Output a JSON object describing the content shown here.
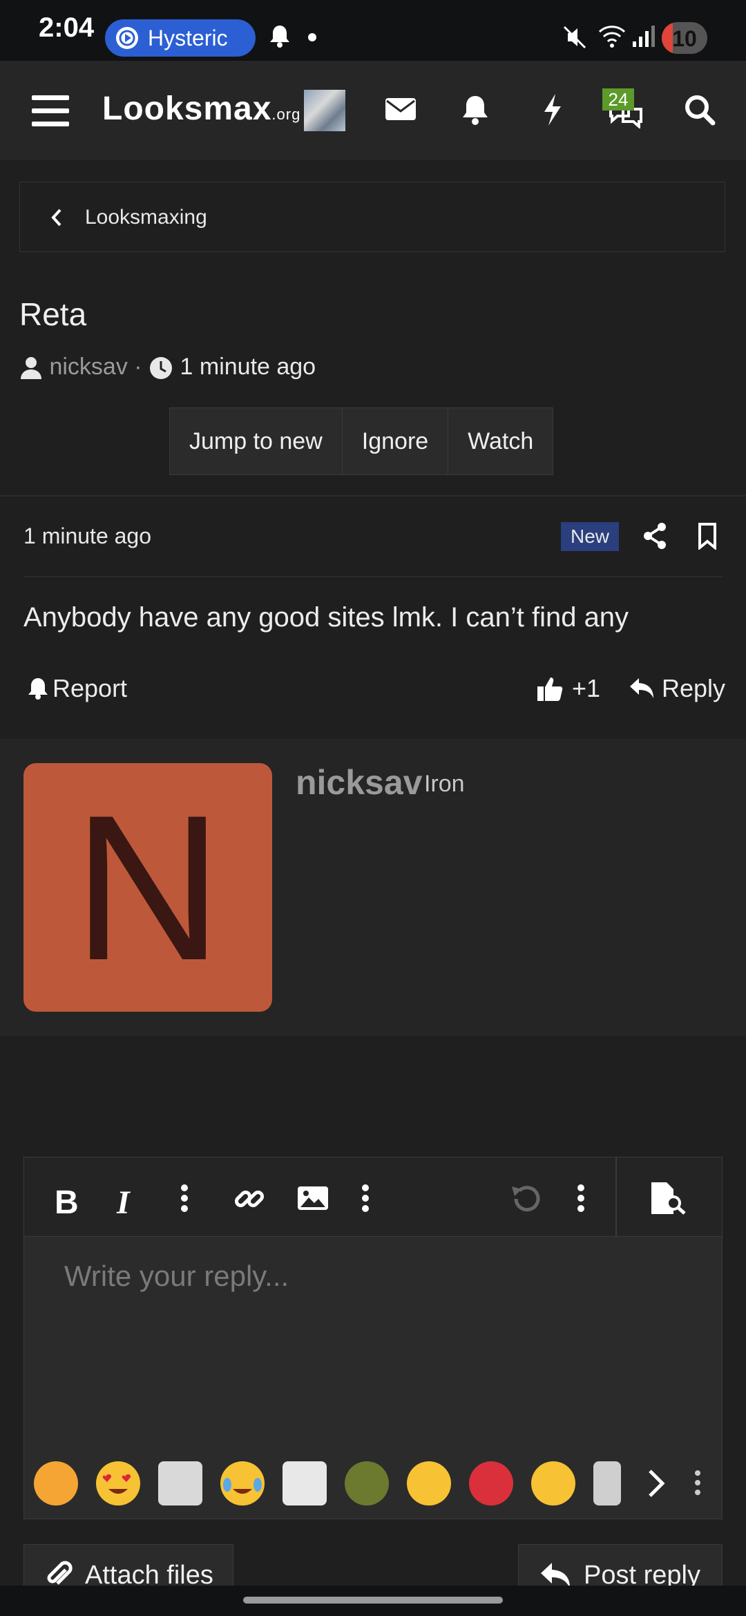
{
  "status_bar": {
    "time": "2:04",
    "media_pill_label": "Hysteric",
    "battery_level": "10",
    "icons": [
      "media-icon",
      "notification-bell-icon",
      "dot-icon",
      "mute-icon",
      "wifi-icon",
      "signal-icon",
      "battery-icon"
    ]
  },
  "header": {
    "logo_main": "Looksmax",
    "logo_suffix": ".org",
    "chat_badge": "24",
    "icons": [
      "menu-icon",
      "mail-icon",
      "bell-icon",
      "lightning-icon",
      "chat-icon",
      "search-icon"
    ]
  },
  "breadcrumb": {
    "label": "Looksmaxing"
  },
  "thread": {
    "title": "Reta",
    "author": "nicksav",
    "separator": "·",
    "time_ago": "1 minute ago",
    "actions": [
      "Jump to new",
      "Ignore",
      "Watch"
    ]
  },
  "post": {
    "time_ago": "1 minute ago",
    "badge": "New",
    "body": "Anybody have any good sites lmk. I can’t find any",
    "report_label": "Report",
    "like_count": "+1",
    "reply_label": "Reply"
  },
  "user_card": {
    "avatar_letter": "N",
    "username": "nicksav",
    "user_title": "Iron"
  },
  "editor": {
    "placeholder": "Write your reply...",
    "toolbar_icons": [
      "bold-icon",
      "italic-icon",
      "more-vertical-icon",
      "link-icon",
      "image-icon",
      "more-vertical-icon",
      "undo-icon",
      "more-vertical-icon",
      "preview-icon"
    ]
  },
  "footer": {
    "attach_label": "Attach files",
    "post_reply_label": "Post reply"
  },
  "colors": {
    "background": "#1f1f1f",
    "header": "#262626",
    "new_badge": "#2b3e7d",
    "avatar": "#bd593a",
    "chat_badge": "#5c9a2a",
    "media_pill": "#2c5fd3"
  }
}
